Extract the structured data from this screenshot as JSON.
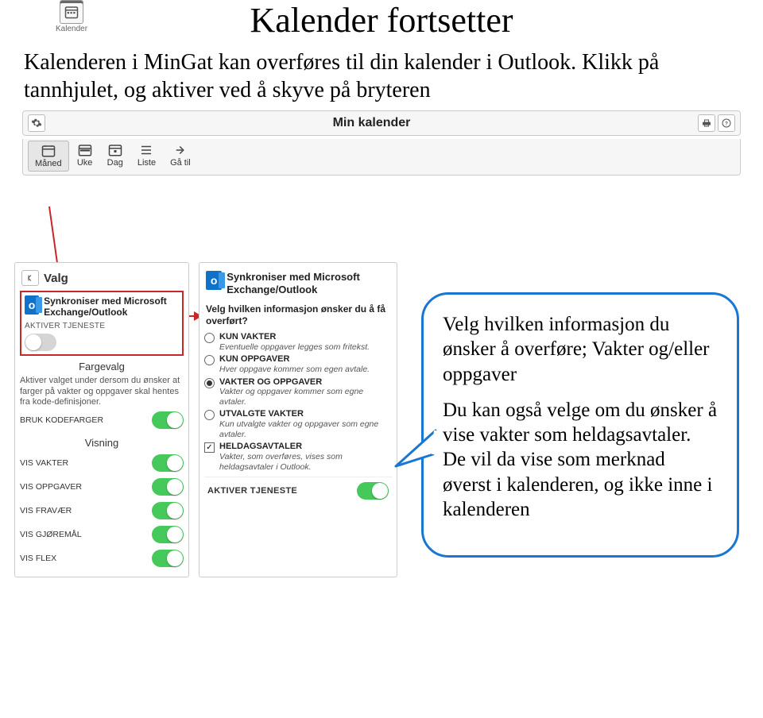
{
  "corner": {
    "caption": "Kalender"
  },
  "title": "Kalender fortsetter",
  "intro": "Kalenderen i MinGat kan overføres til din kalender i Outlook. Klikk på tannhjulet, og aktiver ved å skyve på bryteren",
  "panel": {
    "title": "Min kalender"
  },
  "tabs": {
    "maned": "Måned",
    "uke": "Uke",
    "dag": "Dag",
    "liste": "Liste",
    "gatil": "Gå til"
  },
  "valg_card": {
    "header": "Valg",
    "outlook_glyph": "o",
    "sync_title": "Synkroniser med Microsoft Exchange/Outlook",
    "aktiver_label": "AKTIVER TJENESTE",
    "fargevalg_title": "Fargevalg",
    "fargevalg_desc": "Aktiver valget under dersom du ønsker at farger på vakter og oppgaver skal hentes fra kode-definisjoner.",
    "kodefarger_label": "BRUK KODEFARGER",
    "visning_title": "Visning",
    "rows": {
      "vakter": "VIS VAKTER",
      "oppgaver": "VIS OPPGAVER",
      "fravaer": "VIS FRAVÆR",
      "gjoremal": "VIS GJØREMÅL",
      "flex": "VIS FLEX"
    }
  },
  "options_card": {
    "outlook_glyph": "o",
    "sync_title": "Synkroniser med Microsoft Exchange/Outlook",
    "question": "Velg hvilken informasjon ønsker du å få overført?",
    "opts": {
      "kun_vakter": {
        "label": "KUN VAKTER",
        "desc": "Eventuelle oppgaver legges som fritekst."
      },
      "kun_oppgaver": {
        "label": "KUN OPPGAVER",
        "desc": "Hver oppgave kommer som egen avtale."
      },
      "vakter_og_oppgaver": {
        "label": "VAKTER OG OPPGAVER",
        "desc": "Vakter og oppgaver kommer som egne avtaler."
      },
      "utvalgte_vakter": {
        "label": "UTVALGTE VAKTER",
        "desc": "Kun utvalgte vakter og oppgaver som egne avtaler."
      },
      "heldagsavtaler": {
        "label": "HELDAGSAVTALER",
        "desc": "Vakter, som overføres, vises som heldagsavtaler i Outlook."
      }
    },
    "aktiver_label": "AKTIVER TJENESTE"
  },
  "callout": {
    "p1": "Velg hvilken informasjon du ønsker å overføre; Vakter og/eller oppgaver",
    "p2": "Du kan også velge om du ønsker å vise vakter som heldagsavtaler. De vil da vise som merknad øverst i kalenderen, og ikke inne i kalenderen"
  }
}
